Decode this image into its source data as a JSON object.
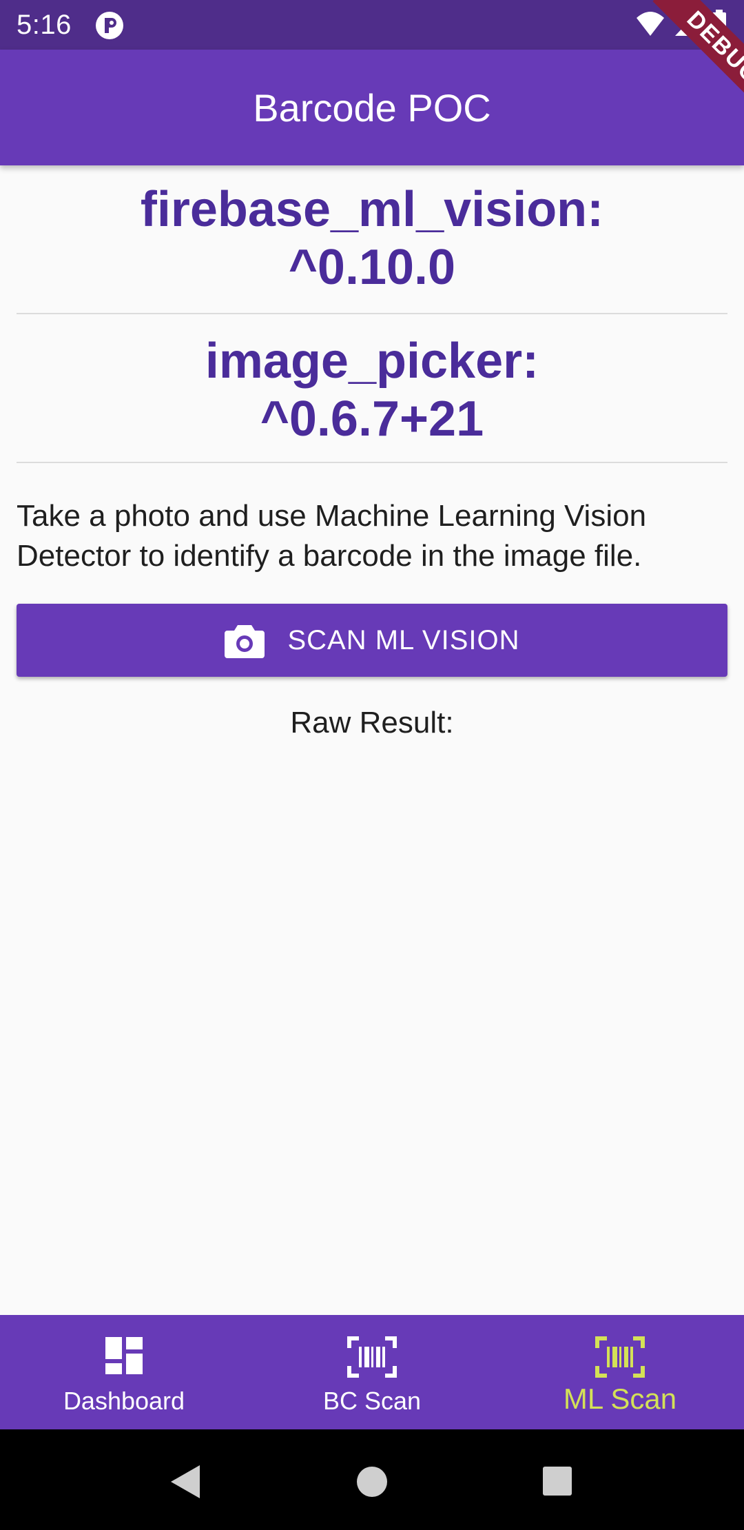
{
  "status_bar": {
    "time": "5:16",
    "icons": [
      "app-notification-icon",
      "wifi-icon",
      "signal-icon",
      "battery-icon"
    ]
  },
  "app_bar": {
    "title": "Barcode POC",
    "debug_banner": "DEBUG",
    "color": "#673ab7"
  },
  "packages": [
    {
      "name": "firebase_ml_vision:",
      "version": "^0.10.0"
    },
    {
      "name": "image_picker:",
      "version": "^0.6.7+21"
    }
  ],
  "description": "Take a photo and use Machine Learning Vision Detector to identify a barcode in the image file.",
  "scan_button": {
    "label": "SCAN ML VISION",
    "icon": "camera-icon"
  },
  "raw_result": {
    "label": "Raw Result:"
  },
  "bottom_nav": {
    "items": [
      {
        "label": "Dashboard",
        "icon": "dashboard-icon",
        "active": false
      },
      {
        "label": "BC Scan",
        "icon": "barcode-scan-icon",
        "active": false
      },
      {
        "label": "ML Scan",
        "icon": "barcode-scan-icon",
        "active": true
      }
    ],
    "active_color": "#d4e157"
  },
  "system_nav": {
    "icons": [
      "back-icon",
      "home-icon",
      "recents-icon"
    ]
  }
}
